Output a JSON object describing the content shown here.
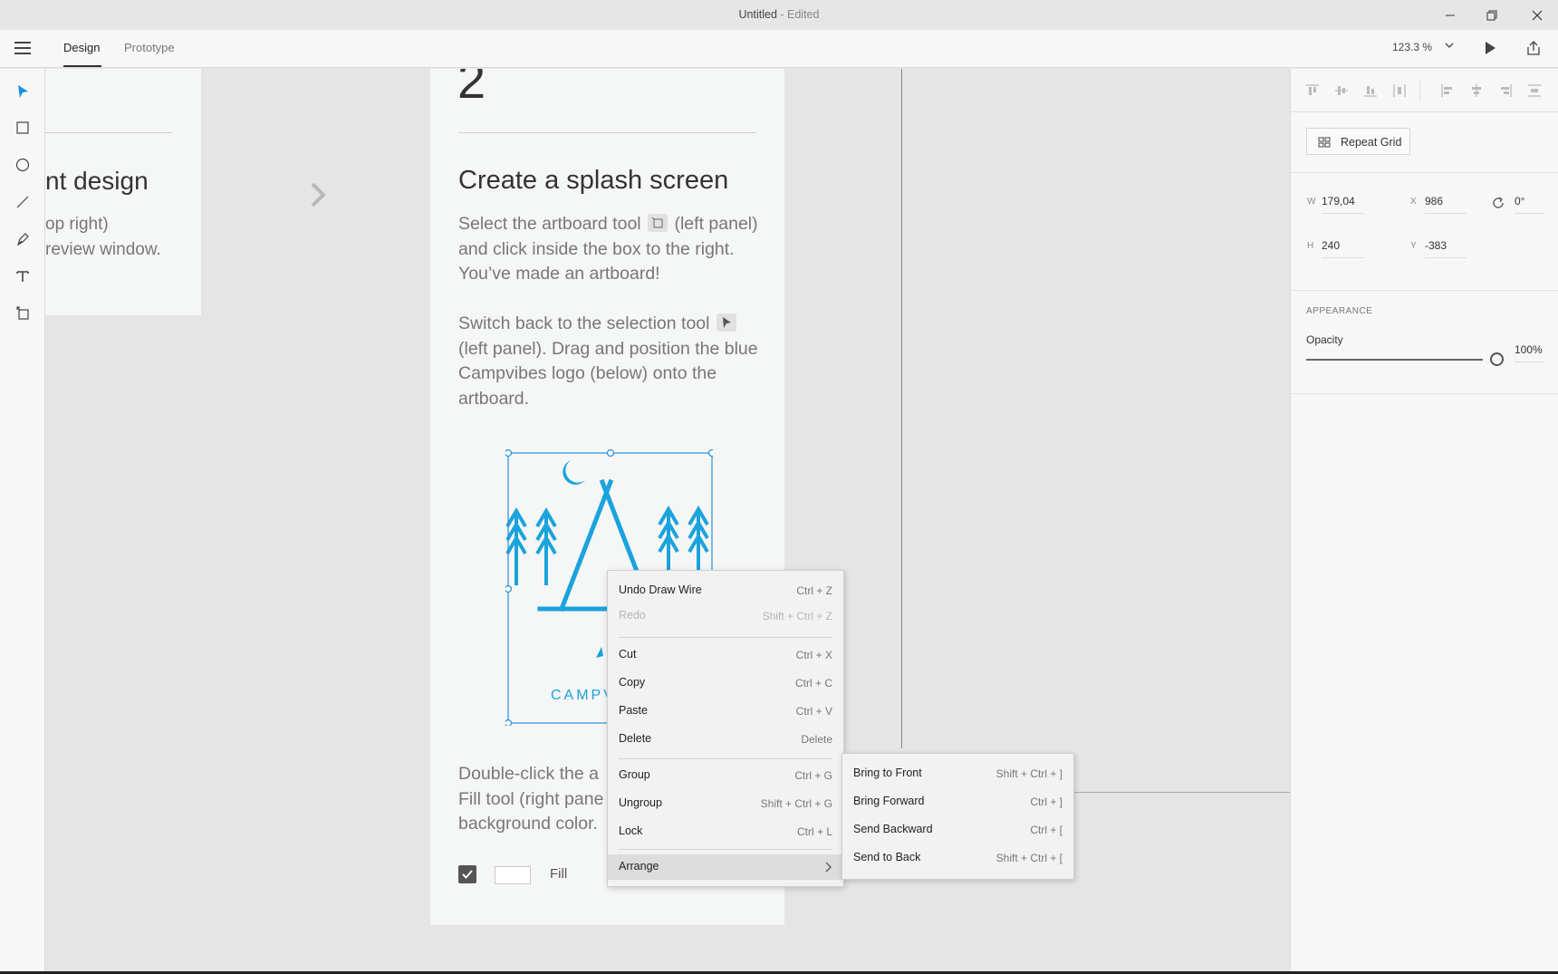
{
  "window": {
    "title": "Untitled",
    "title_suffix": " - Edited"
  },
  "appbar": {
    "tabs": [
      {
        "label": "Design"
      },
      {
        "label": "Prototype"
      }
    ],
    "zoom": "123.3 %"
  },
  "canvas": {
    "left_artboard": {
      "heading": "nt design",
      "body_line1": "op right)",
      "body_line2": "review window."
    },
    "main_artboard": {
      "step_number": "2",
      "heading": "Create a splash screen",
      "para1_a": "Select the artboard tool",
      "para1_b": "(left panel) and click inside the box to the right. You’ve made an artboard!",
      "para2_a": "Switch back to the selection tool",
      "para2_b": "(left panel). Drag and position the blue Campvibes logo (below) onto the artboard.",
      "para3": "Double-click the a Fill tool (right pane background color.",
      "fill_label": "Fill",
      "logo_text": "CAMPV",
      "logo_color": "#1aa3dc"
    }
  },
  "right_panel": {
    "repeat_grid_label": "Repeat Grid",
    "w_label": "W",
    "w_value": "179,04",
    "x_label": "X",
    "x_value": "986",
    "h_label": "H",
    "h_value": "240",
    "y_label": "Y",
    "y_value": "-383",
    "rotation_value": "0°",
    "appearance_title": "APPEARANCE",
    "opacity_label": "Opacity",
    "opacity_value": "100%",
    "opacity_level": 1.0
  },
  "context_menu": {
    "items": [
      {
        "label": "Undo Draw Wire",
        "shortcut": "Ctrl + Z"
      },
      {
        "label": "Redo",
        "shortcut": "Shift + Ctrl + Z"
      },
      {
        "label": "Cut",
        "shortcut": "Ctrl + X"
      },
      {
        "label": "Copy",
        "shortcut": "Ctrl + C"
      },
      {
        "label": "Paste",
        "shortcut": "Ctrl + V"
      },
      {
        "label": "Delete",
        "shortcut": "Delete"
      },
      {
        "label": "Group",
        "shortcut": "Ctrl + G"
      },
      {
        "label": "Ungroup",
        "shortcut": "Shift + Ctrl + G"
      },
      {
        "label": "Lock",
        "shortcut": "Ctrl + L"
      },
      {
        "label": "Arrange"
      }
    ]
  },
  "arrange_submenu": {
    "items": [
      {
        "label": "Bring to Front",
        "shortcut": "Shift + Ctrl + ]"
      },
      {
        "label": "Bring Forward",
        "shortcut": "Ctrl + ]"
      },
      {
        "label": "Send Backward",
        "shortcut": "Ctrl + ["
      },
      {
        "label": "Send to Back",
        "shortcut": "Shift + Ctrl + ["
      }
    ]
  },
  "colors": {
    "accent": "#1aa3dc",
    "selection": "#2a8fd8"
  }
}
